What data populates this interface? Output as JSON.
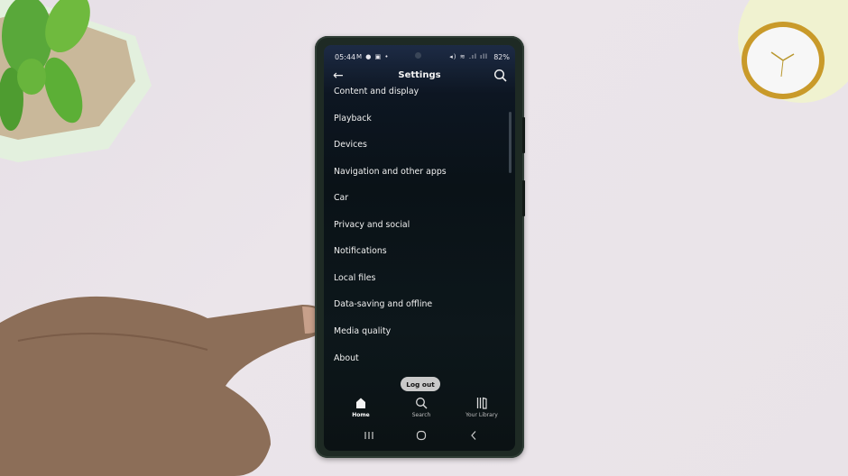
{
  "status_bar": {
    "time": "05:44",
    "left_icons": "M ● ▣ •",
    "right_icons": "◂) ≋ .ıl ıll",
    "battery": "82%"
  },
  "app_bar": {
    "title": "Settings",
    "back_icon": "arrow-left-icon",
    "search_icon": "search-icon"
  },
  "menu": {
    "items": [
      {
        "label": "Content and display"
      },
      {
        "label": "Playback"
      },
      {
        "label": "Devices"
      },
      {
        "label": "Navigation and other apps"
      },
      {
        "label": "Car"
      },
      {
        "label": "Privacy and social"
      },
      {
        "label": "Notifications"
      },
      {
        "label": "Local files"
      },
      {
        "label": "Data-saving and offline"
      },
      {
        "label": "Media quality"
      },
      {
        "label": "About"
      }
    ]
  },
  "logout_label": "Log out",
  "bottom_nav": {
    "tabs": [
      {
        "label": "Home",
        "icon": "home-icon",
        "active": true
      },
      {
        "label": "Search",
        "icon": "search-icon",
        "active": false
      },
      {
        "label": "Your Library",
        "icon": "library-icon",
        "active": false
      }
    ]
  },
  "system_nav": {
    "recents": "recents-icon",
    "home": "home-circle-icon",
    "back": "back-chevron-icon"
  },
  "colors": {
    "screen_bg": "#0a1217",
    "header_bg": "#1d2b45",
    "text": "#f0f0f0",
    "logout_bg": "#c9c9c9",
    "phone_case": "#1e2a24",
    "surface": "#e8e2e7"
  }
}
